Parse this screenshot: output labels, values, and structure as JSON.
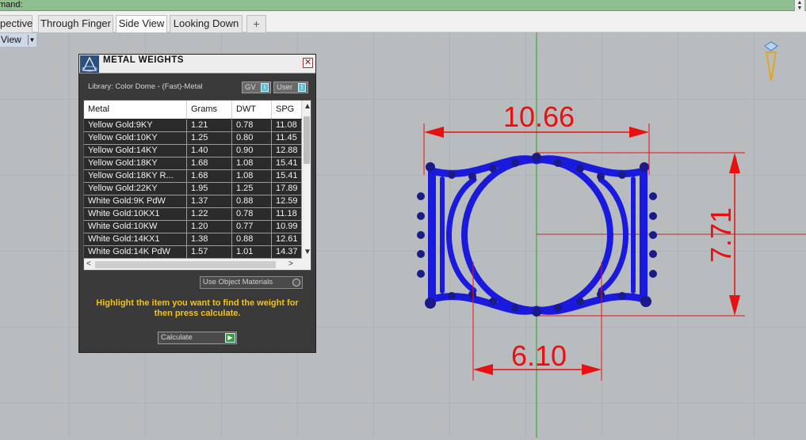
{
  "command": {
    "label": "mand:"
  },
  "tabs": [
    {
      "label": "pective"
    },
    {
      "label": "Through Finger"
    },
    {
      "label": "Side View"
    },
    {
      "label": "Looking Down"
    },
    {
      "label": "+"
    }
  ],
  "viewport": {
    "label": "View"
  },
  "dialog": {
    "title": "METAL WEIGHTS",
    "library": "Library: Color Dome - (Fast)-Metal",
    "toggle_gv": "GV",
    "toggle_user": "User",
    "columns": [
      "Metal",
      "Grams",
      "DWT",
      "SPG"
    ],
    "rows": [
      [
        "Yellow Gold:9KY",
        "1.21",
        "0.78",
        "11.08"
      ],
      [
        "Yellow Gold:10KY",
        "1.25",
        "0.80",
        "11.45"
      ],
      [
        "Yellow Gold:14KY",
        "1.40",
        "0.90",
        "12.88"
      ],
      [
        "Yellow Gold:18KY",
        "1.68",
        "1.08",
        "15.41"
      ],
      [
        "Yellow Gold:18KY R...",
        "1.68",
        "1.08",
        "15.41"
      ],
      [
        "Yellow Gold:22KY",
        "1.95",
        "1.25",
        "17.89"
      ],
      [
        "White Gold:9K PdW",
        "1.37",
        "0.88",
        "12.59"
      ],
      [
        "White Gold:10KX1",
        "1.22",
        "0.78",
        "11.18"
      ],
      [
        "White Gold:10KW",
        "1.20",
        "0.77",
        "10.99"
      ],
      [
        "White Gold:14KX1",
        "1.38",
        "0.88",
        "12.61"
      ],
      [
        "White Gold:14K PdW",
        "1.57",
        "1.01",
        "14.37"
      ]
    ],
    "use_object_materials": "Use Object Materials",
    "hint": "Highlight the item you want to find the weight for then press calculate.",
    "calculate": "Calculate"
  },
  "dimensions": {
    "width": "10.66",
    "height": "7.71",
    "inner": "6.10"
  },
  "colors": {
    "ring": "#1a1adf",
    "dimension": "#e81010",
    "grid": "#a9acae",
    "axis_green": "#2aa02a",
    "axis_red": "#b03030"
  }
}
